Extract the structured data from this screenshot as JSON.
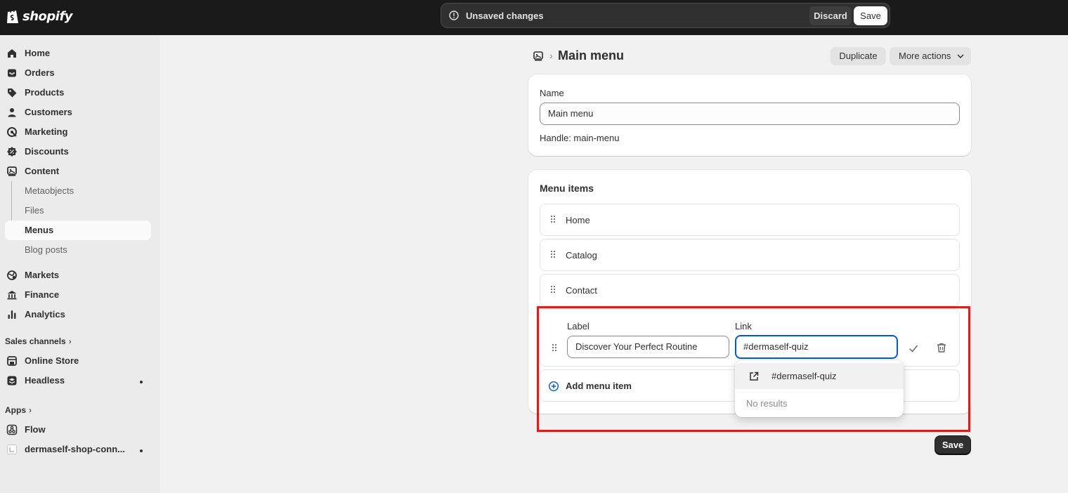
{
  "topbar": {
    "brand": "shopify",
    "unsaved_text": "Unsaved changes",
    "discard_label": "Discard",
    "save_label": "Save"
  },
  "sidebar": {
    "items": [
      {
        "label": "Home",
        "icon": "home-icon"
      },
      {
        "label": "Orders",
        "icon": "inbox-icon"
      },
      {
        "label": "Products",
        "icon": "tag-icon"
      },
      {
        "label": "Customers",
        "icon": "person-icon"
      },
      {
        "label": "Marketing",
        "icon": "target-icon"
      },
      {
        "label": "Discounts",
        "icon": "discount-icon"
      },
      {
        "label": "Content",
        "icon": "content-icon"
      }
    ],
    "content_sub": [
      {
        "label": "Metaobjects"
      },
      {
        "label": "Files"
      },
      {
        "label": "Menus"
      },
      {
        "label": "Blog posts"
      }
    ],
    "items2": [
      {
        "label": "Markets",
        "icon": "globe-icon"
      },
      {
        "label": "Finance",
        "icon": "bank-icon"
      },
      {
        "label": "Analytics",
        "icon": "bar-chart-icon"
      }
    ],
    "sales_channels_label": "Sales channels",
    "channels": [
      {
        "label": "Online Store",
        "icon": "store-icon"
      },
      {
        "label": "Headless",
        "icon": "layers-icon"
      }
    ],
    "apps_label": "Apps",
    "apps": [
      {
        "label": "Flow",
        "icon": "flow-icon"
      },
      {
        "label": "dermaself-shop-conn...",
        "icon": "app-icon"
      }
    ]
  },
  "page": {
    "breadcrumb_sep": "›",
    "title": "Main menu",
    "duplicate_label": "Duplicate",
    "more_actions_label": "More actions"
  },
  "name_card": {
    "name_label": "Name",
    "name_value": "Main menu",
    "handle_text": "Handle: main-menu"
  },
  "menu_card": {
    "title": "Menu items",
    "items": [
      {
        "label": "Home"
      },
      {
        "label": "Catalog"
      },
      {
        "label": "Contact"
      }
    ],
    "edit": {
      "label_label": "Label",
      "label_value": "Discover Your Perfect Routine",
      "link_label": "Link",
      "link_value": "#dermaself-quiz"
    },
    "add_label": "Add menu item"
  },
  "dropdown": {
    "option": "#dermaself-quiz",
    "empty_text": "No results"
  },
  "footer": {
    "save_label": "Save"
  },
  "colors": {
    "topbar_bg": "#1a1a1a",
    "focus_blue": "#005bd3",
    "highlight_red": "#d91e1e",
    "add_icon_blue": "#005bd3"
  }
}
